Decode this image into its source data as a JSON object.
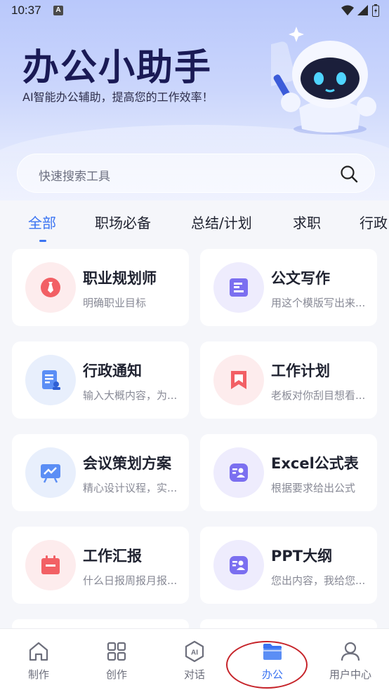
{
  "status_bar": {
    "time": "10:37",
    "notif_glyph": "A"
  },
  "hero": {
    "title": "办公小助手",
    "subtitle": "AI智能办公辅助，提高您的工作效率！"
  },
  "search": {
    "placeholder": "快速搜索工具"
  },
  "tabs": [
    "全部",
    "职场必备",
    "总结/计划",
    "求职",
    "行政"
  ],
  "active_tab": "全部",
  "cards": [
    {
      "title": "职业规划师",
      "desc": "明确职业目标",
      "icon": "tie-icon",
      "color": "#f26065"
    },
    {
      "title": "公文写作",
      "desc": "用这个模版写出来...",
      "icon": "document-icon",
      "color": "#7b6ff0"
    },
    {
      "title": "行政通知",
      "desc": "输入大概内容，为...",
      "icon": "notice-icon",
      "color": "#5b8ef5"
    },
    {
      "title": "工作计划",
      "desc": "老板对你刮目想看...",
      "icon": "bookmark-icon",
      "color": "#f26065"
    },
    {
      "title": "会议策划方案",
      "desc": "精心设计议程，实...",
      "icon": "presentation-icon",
      "color": "#5b8ef5"
    },
    {
      "title": "Excel公式表",
      "desc": "根据要求给出公式",
      "icon": "formula-icon",
      "color": "#7b6ff0"
    },
    {
      "title": "工作汇报",
      "desc": "什么日报周报月报...",
      "icon": "calendar-icon",
      "color": "#f26065"
    },
    {
      "title": "PPT大纲",
      "desc": "您出内容，我给您...",
      "icon": "ppt-icon",
      "color": "#7b6ff0"
    }
  ],
  "bottom_nav": [
    {
      "label": "制作",
      "icon": "home-icon"
    },
    {
      "label": "创作",
      "icon": "grid-icon"
    },
    {
      "label": "对话",
      "icon": "ai-chat-icon",
      "glyph": "AI"
    },
    {
      "label": "办公",
      "icon": "folder-icon"
    },
    {
      "label": "用户中心",
      "icon": "user-icon"
    }
  ],
  "active_nav": "办公",
  "colors": {
    "accent": "#3b74f2",
    "highlight_ring": "#c6242a"
  }
}
